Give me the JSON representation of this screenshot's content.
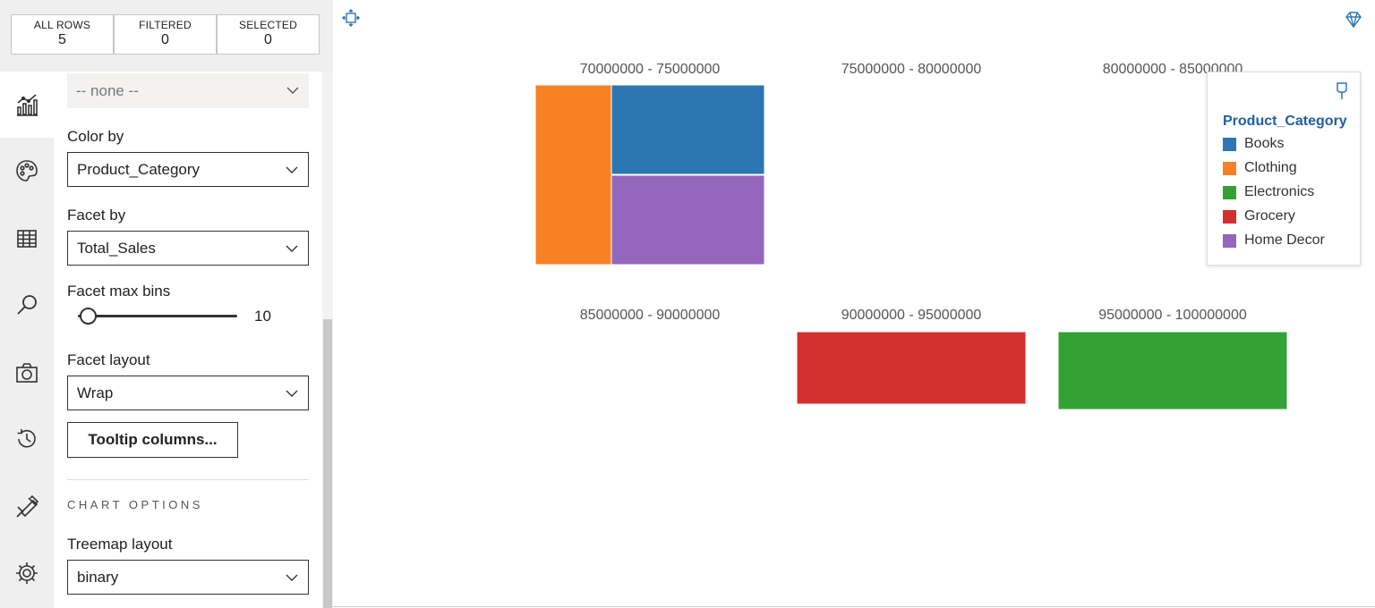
{
  "counts": [
    {
      "label": "ALL ROWS",
      "value": "5"
    },
    {
      "label": "FILTERED",
      "value": "0"
    },
    {
      "label": "SELECTED",
      "value": "0"
    }
  ],
  "nav": [
    "chart-icon",
    "palette-icon",
    "table-icon",
    "search-icon",
    "camera-icon",
    "history-icon",
    "tools-icon",
    "settings-gear-icon"
  ],
  "settings": {
    "top_dropdown": "-- none --",
    "color_by_label": "Color by",
    "color_by_value": "Product_Category",
    "facet_by_label": "Facet by",
    "facet_by_value": "Total_Sales",
    "facet_max_bins_label": "Facet max bins",
    "facet_max_bins_value": "10",
    "facet_max_bins_slider": 0.02,
    "facet_layout_label": "Facet layout",
    "facet_layout_value": "Wrap",
    "tooltip_button": "Tooltip columns...",
    "chart_options_title": "CHART OPTIONS",
    "treemap_layout_label": "Treemap layout",
    "treemap_layout_value": "binary"
  },
  "legend": {
    "title": "Product_Category",
    "items": [
      {
        "label": "Books",
        "color": "#2c77b3"
      },
      {
        "label": "Clothing",
        "color": "#f88125"
      },
      {
        "label": "Electronics",
        "color": "#34a135"
      },
      {
        "label": "Grocery",
        "color": "#d32f2f"
      },
      {
        "label": "Home Decor",
        "color": "#9467bc"
      }
    ]
  },
  "chart_data": {
    "type": "treemap",
    "facet_by": "Total_Sales",
    "color_by": "Product_Category",
    "facets": [
      {
        "title": "70000000 - 75000000",
        "cells": [
          {
            "category": "Clothing",
            "color": "#f88125"
          },
          {
            "category": "Books",
            "color": "#2c77b3"
          },
          {
            "category": "Home Decor",
            "color": "#9467bc"
          }
        ]
      },
      {
        "title": "75000000 - 80000000",
        "cells": []
      },
      {
        "title": "80000000 - 85000000",
        "cells": []
      },
      {
        "title": "85000000 - 90000000",
        "cells": []
      },
      {
        "title": "90000000 - 95000000",
        "cells": [
          {
            "category": "Grocery",
            "color": "#d32f2f"
          }
        ]
      },
      {
        "title": "95000000 - 100000000",
        "cells": [
          {
            "category": "Electronics",
            "color": "#34a135"
          }
        ]
      }
    ]
  }
}
